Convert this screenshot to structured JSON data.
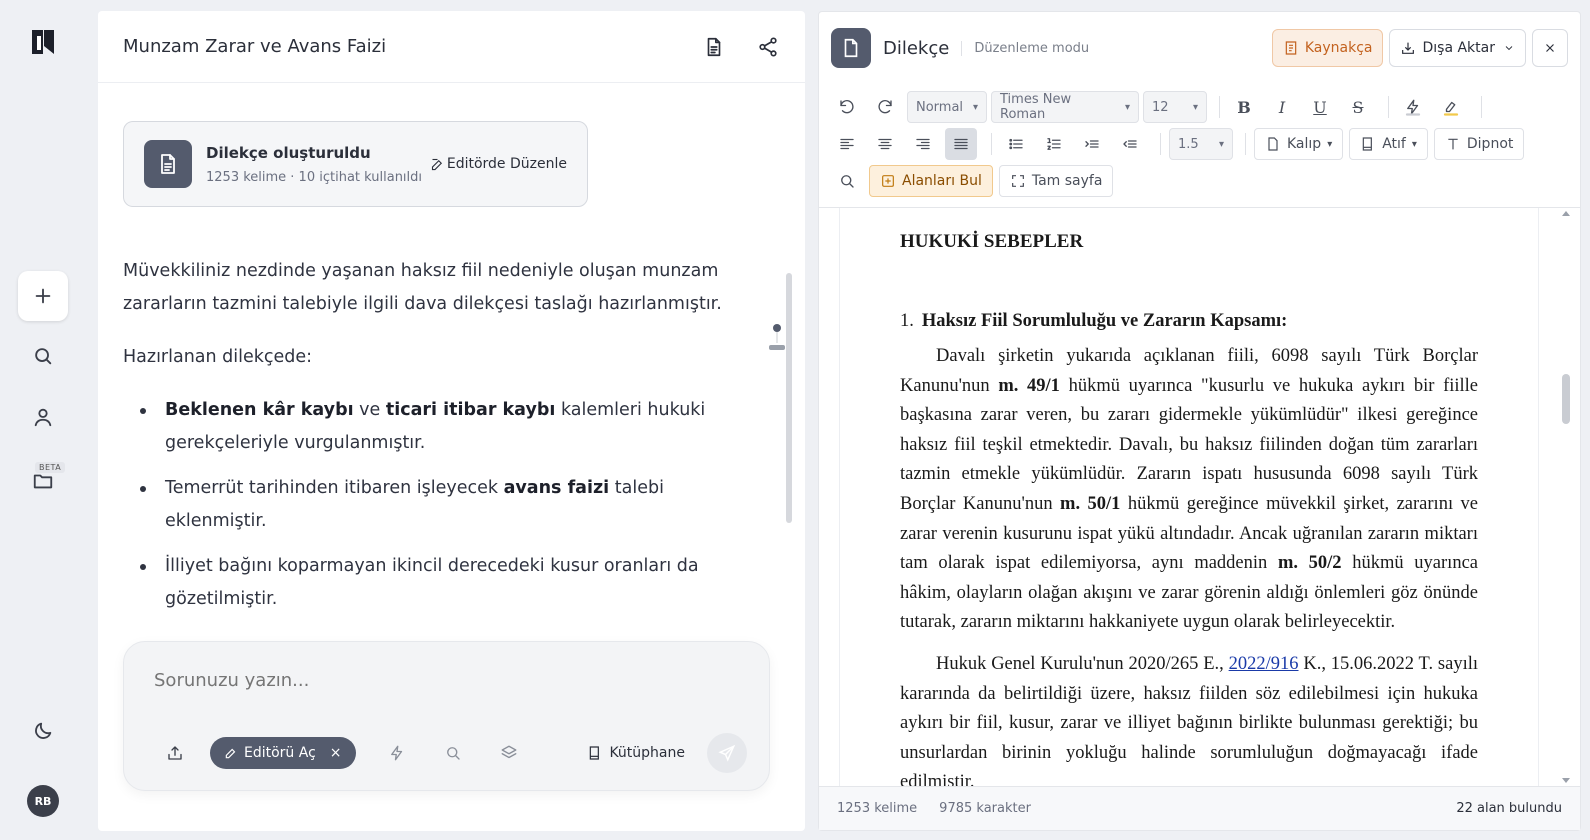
{
  "rail": {
    "beta_label": "BETA",
    "avatar_initials": "RB"
  },
  "chat": {
    "title": "Munzam Zarar ve Avans Faizi",
    "doc_card": {
      "title": "Dilekçe oluşturuldu",
      "meta": "1253 kelime · 10 içtihat kullanıldı",
      "edit_label": "Editörde Düzenle"
    },
    "message": {
      "p1": "Müvekkiliniz nezdinde yaşanan haksız fiil nedeniyle oluşan munzam zararların tazmini talebiyle ilgili dava dilekçesi taslağı hazırlanmıştır.",
      "p2": "Hazırlanan dilekçede:",
      "b1_bold1": "Beklenen kâr kaybı",
      "b1_t1": " ve ",
      "b1_bold2": "ticari itibar kaybı",
      "b1_t2": " kalemleri hukuki gerekçeleriyle vurgulanmıştır.",
      "b2_t1": "Temerrüt tarihinden itibaren işleyecek ",
      "b2_bold": "avans faizi",
      "b2_t2": " talebi eklenmiştir.",
      "b3": "İlliyet bağını koparmayan ikincil derecedeki kusur oranları da gözetilmiştir."
    },
    "composer": {
      "placeholder": "Sorunuzu yazın...",
      "chip_label": "Editörü Aç",
      "chip_close": "×",
      "library_label": "Kütüphane"
    }
  },
  "editor": {
    "title": "Dilekçe",
    "mode": "Düzenleme modu",
    "bibliography_label": "Kaynakça",
    "export_label": "Dışa Aktar",
    "toolbar": {
      "style": "Normal",
      "font": "Times New Roman",
      "size": "12",
      "bold": "B",
      "italic": "I",
      "underline": "U",
      "strike": "S",
      "line_spacing": "1.5",
      "template_label": "Kalıp",
      "citation_label": "Atıf",
      "footnote_label": "Dipnot",
      "find_fields_label": "Alanları Bul",
      "fullpage_label": "Tam sayfa"
    },
    "document": {
      "section_title": "HUKUKİ SEBEPLER",
      "sub_num": "1.",
      "sub_title": "Haksız Fiil Sorumluluğu ve Zararın Kapsamı:",
      "p1_a": "Davalı şirketin yukarıda açıklanan fiili, 6098 sayılı Türk Borçlar Kanunu'nun ",
      "p1_b": "m. 49/1",
      "p1_c": " hükmü uyarınca \"kusurlu ve hukuka aykırı bir fiille başkasına zarar veren, bu zararı gidermekle yükümlüdür\" ilkesi gereğince haksız fiil teşkil etmektedir. Davalı, bu haksız fiilinden doğan tüm zararları tazmin etmekle yükümlüdür. Zararın ispatı hususunda 6098 sayılı Türk Borçlar Kanunu'nun ",
      "p1_d": "m. 50/1",
      "p1_e": " hükmü gereğince müvekkil şirket, zararını ve zarar verenin kusurunu ispat yükü altındadır. Ancak uğranılan zararın miktarı tam olarak ispat edilemiyorsa, aynı maddenin ",
      "p1_f": "m. 50/2",
      "p1_g": " hükmü uyarınca hâkim, olayların olağan akışını ve zarar görenin aldığı önlemleri göz önünde tutarak, zararın miktarını hakkaniyete uygun olarak belirleyecektir.",
      "p2_a": "Hukuk Genel Kurulu'nun 2020/265 E., ",
      "p2_link": "2022/916",
      "p2_b": " K., 15.06.2022 T. sayılı kararında da belirtildiği üzere, haksız fiilden söz edilebilmesi için hukuka aykırı bir fiil, kusur, zarar ve illiyet bağının birlikte bulunması gerektiği; bu unsurlardan birinin yokluğu halinde sorumluluğun doğmayacağı ifade edilmiştir."
    },
    "status": {
      "words": "1253 kelime",
      "chars": "9785 karakter",
      "fields": "22 alan bulundu"
    }
  }
}
